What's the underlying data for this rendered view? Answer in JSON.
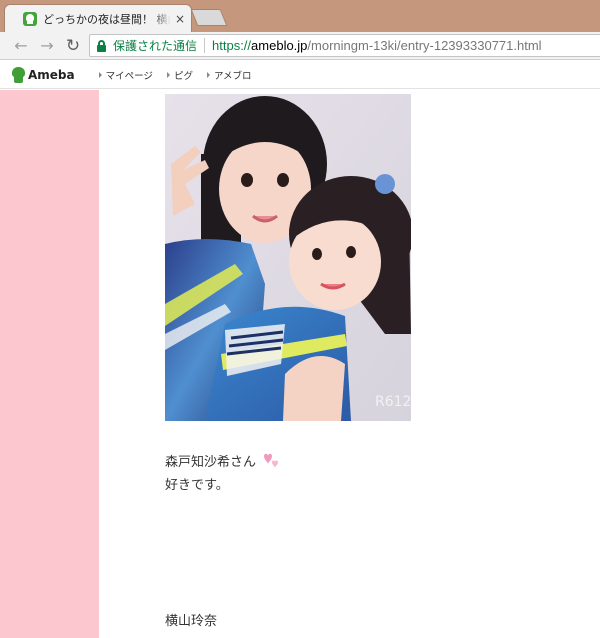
{
  "browser": {
    "tab": {
      "title": "どっちかの夜は昼間！ 横山玲奈",
      "close": "×",
      "favicon": "ameba-icon"
    },
    "toolbar": {
      "back": "←",
      "forward": "→",
      "reload": "↻",
      "security_label": "保護された通信",
      "url_scheme": "https://",
      "url_host": "ameblo.jp",
      "url_path": "/morningm-13ki/entry-12393330771.html"
    }
  },
  "ameba_bar": {
    "logo": "Ameba",
    "links": [
      "マイページ",
      "ピグ",
      "アメブロ"
    ]
  },
  "entry": {
    "photo": "photo-two-girls-selfie",
    "photo_watermark": "R612",
    "line1": "森戸知沙希さん",
    "line2": "好きです。",
    "signature": "横山玲奈",
    "emoji": "pink-hearts-icon"
  },
  "colors": {
    "tabstrip": "#c5977c",
    "left_band": "#fdc7cf",
    "secure_green": "#0b8043",
    "ameba_green": "#3f9e35"
  }
}
